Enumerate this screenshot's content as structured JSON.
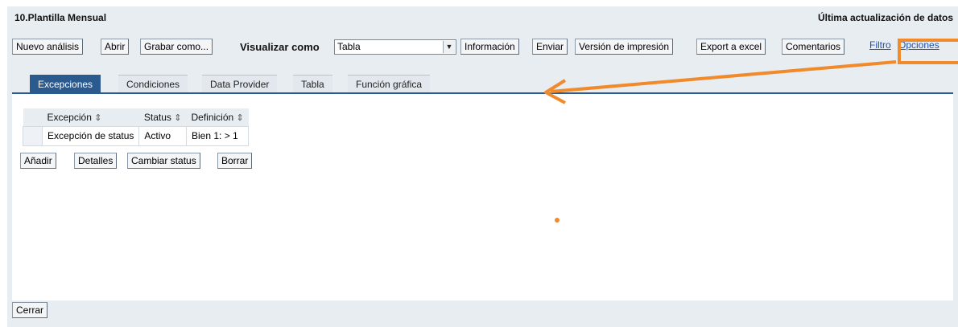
{
  "window": {
    "title": "10.Plantilla Mensual",
    "last_update": "Última actualización de datos"
  },
  "toolbar": {
    "buttons": [
      "Nuevo análisis",
      "Abrir",
      "Grabar como...",
      "Información",
      "Enviar",
      "Versión de impresión",
      "Export a excel",
      "Comentarios"
    ],
    "view_as_label": "Visualizar como",
    "view_as_value": "Tabla",
    "links": [
      "Filtro",
      "Opciones"
    ]
  },
  "tabs": {
    "items": [
      "Excepciones",
      "Condiciones",
      "Data Provider",
      "Tabla",
      "Función gráfica"
    ],
    "active": "Excepciones"
  },
  "grid": {
    "columns": [
      "Excepción",
      "Status",
      "Definición"
    ],
    "rows": [
      {
        "name": "Excepción de status",
        "status": "Activo",
        "definition": "Bien 1: > 1"
      }
    ]
  },
  "grid_actions": [
    "Añadir",
    "Detalles",
    "Cambiar status",
    "Borrar"
  ],
  "footer": {
    "close_label": "Cerrar"
  },
  "annotation": {
    "color": "#f08a2a"
  },
  "theme": {
    "accent": "#2a5a8e",
    "link": "#2152a8",
    "background": "#e8edf2"
  }
}
